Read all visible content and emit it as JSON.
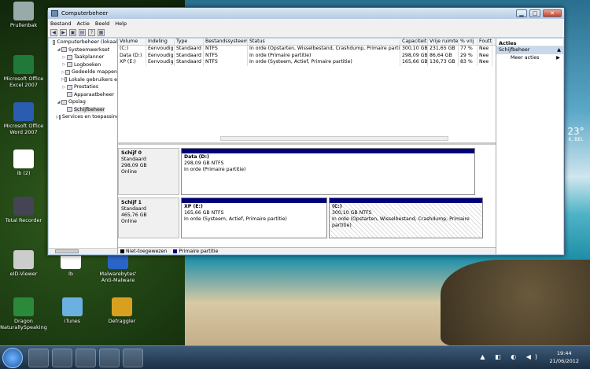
{
  "desktop": {
    "icons": [
      {
        "label": "Prullenbak",
        "icon": "recycle-bin-icon"
      },
      {
        "label": "Microsoft Office Excel 2007",
        "icon": "excel-icon"
      },
      {
        "label": "Microsoft Office Word 2007",
        "icon": "word-icon"
      },
      {
        "label": "ib (2)",
        "icon": "ib-icon"
      },
      {
        "label": "Total Recorder",
        "icon": "speaker-icon"
      },
      {
        "label": "eID-Viewer",
        "icon": "eid-icon"
      },
      {
        "label": "Ib",
        "icon": "ib-icon"
      },
      {
        "label": "Malwarebytes' Anti-Malware",
        "icon": "malwarebytes-icon"
      },
      {
        "label": "Dragon NaturallySpeaking",
        "icon": "dragon-icon"
      },
      {
        "label": "iTunes",
        "icon": "itunes-icon"
      },
      {
        "label": "Defraggler",
        "icon": "defraggler-icon"
      }
    ],
    "gadget": {
      "temp": "23°",
      "place": "K, BEL"
    }
  },
  "window": {
    "title": "Computerbeheer",
    "menu": [
      "Bestand",
      "Actie",
      "Beeld",
      "Help"
    ],
    "controls": {
      "min": "▁",
      "max": "□",
      "close": "✕"
    }
  },
  "tree": [
    {
      "label": "Computerbeheer (lokaal",
      "level": 0,
      "exp": ""
    },
    {
      "label": "Systeemwerkset",
      "level": 1,
      "exp": "◢"
    },
    {
      "label": "Taakplanner",
      "level": 2,
      "exp": "▷"
    },
    {
      "label": "Logboeken",
      "level": 2,
      "exp": "▷"
    },
    {
      "label": "Gedeelde mappen",
      "level": 2,
      "exp": "▷"
    },
    {
      "label": "Lokale gebruikers e",
      "level": 2,
      "exp": "▷"
    },
    {
      "label": "Prestaties",
      "level": 2,
      "exp": "▷"
    },
    {
      "label": "Apparaatbeheer",
      "level": 2,
      "exp": ""
    },
    {
      "label": "Opslag",
      "level": 1,
      "exp": "◢"
    },
    {
      "label": "Schijfbeheer",
      "level": 2,
      "exp": "",
      "selected": true
    },
    {
      "label": "Services en toepassing",
      "level": 1,
      "exp": "▷"
    }
  ],
  "volumes": {
    "headers": [
      "Volume",
      "Indeling",
      "Type",
      "Bestandssysteem",
      "Status",
      "Capaciteit",
      "Vrije ruimte",
      "% vrij",
      "Foutto"
    ],
    "rows": [
      [
        "(C:)",
        "Eenvoudig",
        "Standaard",
        "NTFS",
        "In orde (Opstarten, Wisselbestand, Crashdump, Primaire partitie)",
        "300,10 GB",
        "231,65 GB",
        "77 %",
        "Nee"
      ],
      [
        "Data (D:)",
        "Eenvoudig",
        "Standaard",
        "NTFS",
        "In orde (Primaire partitie)",
        "298,09 GB",
        "86,64 GB",
        "29 %",
        "Nee"
      ],
      [
        "XP (E:)",
        "Eenvoudig",
        "Standaard",
        "NTFS",
        "In orde (Systeem, Actief, Primaire partitie)",
        "165,66 GB",
        "136,73 GB",
        "83 %",
        "Nee"
      ]
    ]
  },
  "disks": [
    {
      "name": "Schijf 0",
      "type": "Standaard",
      "size": "298,09 GB",
      "status": "Online",
      "partitions": [
        {
          "name": "Data  (D:)",
          "size": "298,09 GB NTFS",
          "status": "In orde (Primaire partitie)"
        }
      ]
    },
    {
      "name": "Schijf 1",
      "type": "Standaard",
      "size": "465,76 GB",
      "status": "Online",
      "partitions": [
        {
          "name": "XP  (E:)",
          "size": "165,66 GB NTFS",
          "status": "In orde (Systeem, Actief, Primaire partitie)"
        },
        {
          "name": "(C:)",
          "size": "300,10 GB NTFS",
          "status": "In orde (Opstarten, Wisselbestand, Crashdump, Primaire partitie)"
        }
      ]
    }
  ],
  "legend": [
    {
      "label": "Niet-toegewezen",
      "color": "#000000"
    },
    {
      "label": "Primaire partitie",
      "color": "#00007a"
    }
  ],
  "actions": {
    "header": "Acties",
    "section": "Schijfbeheer",
    "section_arrow": "▲",
    "item": "Meer acties",
    "item_arrow": "▶"
  },
  "taskbar": {
    "time": "19:44",
    "date": "21/06/2012",
    "tray": "▲ ◧ ◐ ◀)"
  }
}
